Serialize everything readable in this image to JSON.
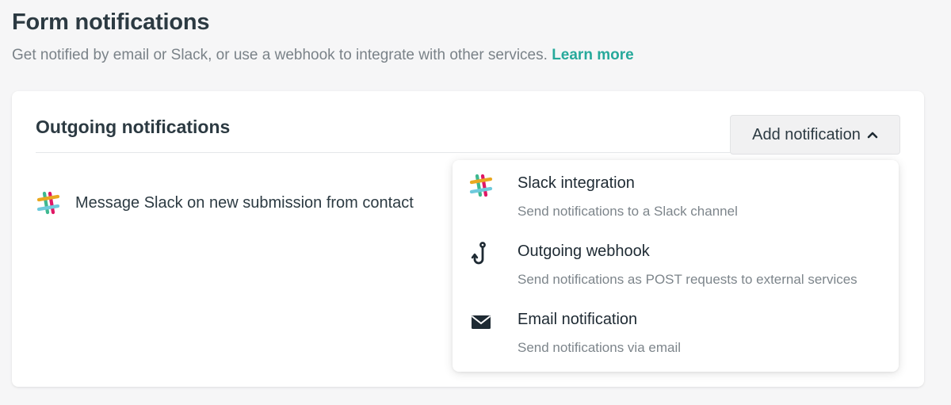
{
  "page": {
    "title": "Form notifications",
    "subtitle": "Get notified by email or Slack, or use a webhook to integrate with other services.",
    "learn_more": "Learn more",
    "accent_color": "#27a99b"
  },
  "card": {
    "title": "Outgoing notifications",
    "add_button_label": "Add notification",
    "add_button_icon": "chevron-up-icon",
    "notifications": [
      {
        "icon": "slack-icon",
        "label": "Message Slack on new submission from contact"
      }
    ]
  },
  "dropdown": {
    "items": [
      {
        "icon": "slack-icon",
        "title": "Slack integration",
        "description": "Send notifications to a Slack channel"
      },
      {
        "icon": "hook-icon",
        "title": "Outgoing webhook",
        "description": "Send notifications as POST requests to external services"
      },
      {
        "icon": "envelope-icon",
        "title": "Email notification",
        "description": "Send notifications via email"
      }
    ]
  }
}
